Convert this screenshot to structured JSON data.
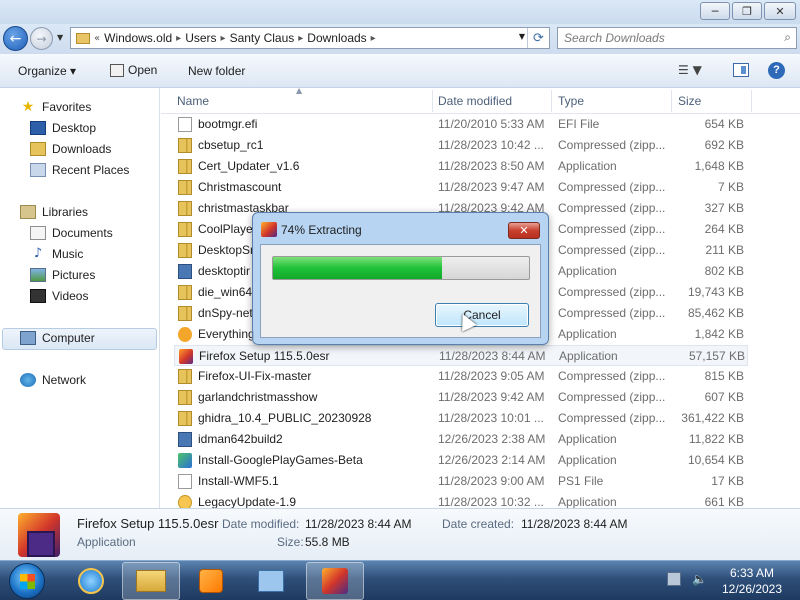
{
  "window": {
    "buttons": {
      "minimize": "─",
      "maximize": "❐",
      "close": "✕"
    }
  },
  "address": {
    "crumbs": [
      "Windows.old",
      "Users",
      "Santy Claus",
      "Downloads"
    ],
    "prefix": "«",
    "search_placeholder": "Search Downloads"
  },
  "toolbar": {
    "organize": "Organize ▾",
    "open": "Open",
    "new_folder": "New folder"
  },
  "nav": {
    "favorites": "Favorites",
    "desktop": "Desktop",
    "downloads": "Downloads",
    "recent": "Recent Places",
    "libraries": "Libraries",
    "documents": "Documents",
    "music": "Music",
    "pictures": "Pictures",
    "videos": "Videos",
    "computer": "Computer",
    "network": "Network"
  },
  "columns": {
    "name": "Name",
    "date": "Date modified",
    "type": "Type",
    "size": "Size"
  },
  "files": [
    {
      "name": "bootmgr.efi",
      "date": "11/20/2010 5:33 AM",
      "type": "EFI File",
      "size": "654 KB",
      "icon": "file-icon"
    },
    {
      "name": "cbsetup_rc1",
      "date": "11/28/2023 10:42 ...",
      "type": "Compressed (zipp...",
      "size": "692 KB",
      "icon": "zip-folder-icon"
    },
    {
      "name": "Cert_Updater_v1.6",
      "date": "11/28/2023 8:50 AM",
      "type": "Application",
      "size": "1,648 KB",
      "icon": "zip-folder-icon"
    },
    {
      "name": "Christmascount",
      "date": "11/28/2023 9:47 AM",
      "type": "Compressed (zipp...",
      "size": "7 KB",
      "icon": "zip-folder-icon"
    },
    {
      "name": "christmastaskbar",
      "date": "11/28/2023 9:42 AM",
      "type": "Compressed (zipp...",
      "size": "327 KB",
      "icon": "zip-folder-icon"
    },
    {
      "name": "CoolPlaye",
      "date": "",
      "type": "Compressed (zipp...",
      "size": "264 KB",
      "icon": "zip-folder-icon"
    },
    {
      "name": "DesktopSr",
      "date": "",
      "type": "Compressed (zipp...",
      "size": "211 KB",
      "icon": "zip-folder-icon"
    },
    {
      "name": "desktoptir",
      "date": "",
      "type": "Application",
      "size": "802 KB",
      "icon": "app-icon"
    },
    {
      "name": "die_win64",
      "date": "",
      "type": "Compressed (zipp...",
      "size": "19,743 KB",
      "icon": "zip-folder-icon"
    },
    {
      "name": "dnSpy-net",
      "date": "",
      "type": "Compressed (zipp...",
      "size": "85,462 KB",
      "icon": "zip-folder-icon"
    },
    {
      "name": "Everything",
      "date": "",
      "type": "Application",
      "size": "1,842 KB",
      "icon": "search-app-icon"
    },
    {
      "name": "Firefox Setup 115.5.0esr",
      "date": "11/28/2023 8:44 AM",
      "type": "Application",
      "size": "57,157 KB",
      "icon": "firefox-setup-icon"
    },
    {
      "name": "Firefox-UI-Fix-master",
      "date": "11/28/2023 9:05 AM",
      "type": "Compressed (zipp...",
      "size": "815 KB",
      "icon": "zip-folder-icon"
    },
    {
      "name": "garlandchristmasshow",
      "date": "11/28/2023 9:42 AM",
      "type": "Compressed (zipp...",
      "size": "607 KB",
      "icon": "zip-folder-icon"
    },
    {
      "name": "ghidra_10.4_PUBLIC_20230928",
      "date": "11/28/2023 10:01 ...",
      "type": "Compressed (zipp...",
      "size": "361,422 KB",
      "icon": "zip-folder-icon"
    },
    {
      "name": "idman642build2",
      "date": "12/26/2023 2:38 AM",
      "type": "Application",
      "size": "11,822 KB",
      "icon": "app-icon"
    },
    {
      "name": "Install-GooglePlayGames-Beta",
      "date": "12/26/2023 2:14 AM",
      "type": "Application",
      "size": "10,654 KB",
      "icon": "play-icon"
    },
    {
      "name": "Install-WMF5.1",
      "date": "11/28/2023 9:00 AM",
      "type": "PS1 File",
      "size": "17 KB",
      "icon": "script-file-icon"
    },
    {
      "name": "LegacyUpdate-1.9",
      "date": "11/28/2023 10:32 ...",
      "type": "Application",
      "size": "661 KB",
      "icon": "gear-app-icon"
    }
  ],
  "details": {
    "name": "Firefox Setup 115.5.0esr",
    "kind": "Application",
    "modified_label": "Date modified:",
    "modified_value": "11/28/2023 8:44 AM",
    "created_label": "Date created:",
    "created_value": "11/28/2023 8:44 AM",
    "size_label": "Size:",
    "size_value": "55.8 MB"
  },
  "dialog": {
    "title": "74% Extracting",
    "progress": 0.66,
    "cancel": "Cancel",
    "close": "✕"
  },
  "taskbar": {
    "time": "6:33 AM",
    "date": "12/26/2023"
  },
  "colors": {
    "accent": "#2f6ab8",
    "progress": "#1fc23a"
  }
}
